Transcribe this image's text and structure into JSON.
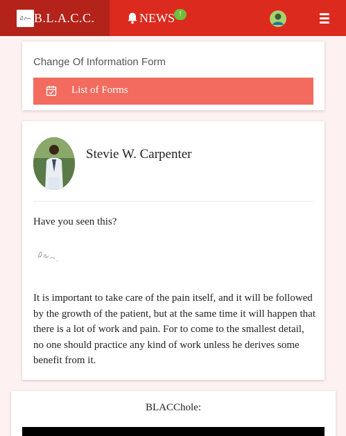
{
  "navbar": {
    "brand_text": "B.L.A.C.C.",
    "news_label": "NEWS",
    "news_badge": "!",
    "colors": {
      "bar": "#dc2a1e",
      "brand_bg": "#b3231a",
      "badge": "#6fbf3a"
    }
  },
  "form_card": {
    "title": "Change Of Information Form",
    "button_label": "List of Forms"
  },
  "post": {
    "author": "Stevie W. Carpenter",
    "heading": "Have you seen this?",
    "body": "It is important to take care of the pain itself, and it will be followed by the growth of the patient, but at the same time it will happen that there is a lot of work and pain. For to come to the smallest detail, no one should practice any kind of work unless he derives some benefit from it."
  },
  "blac_card": {
    "title": "BLACChole:"
  },
  "icons": [
    "brand-logo-icon",
    "bell-icon",
    "user-avatar-icon",
    "menu-icon",
    "calendar-check-icon"
  ]
}
